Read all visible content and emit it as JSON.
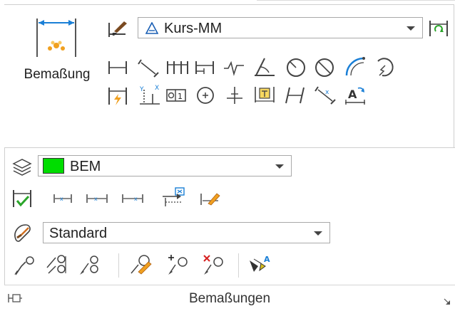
{
  "dimension_panel": {
    "big_button_label": "Bemaßung",
    "dimstyle_combo": {
      "value": "Kurs-MM"
    }
  },
  "dimensions_panel": {
    "layer_combo": {
      "value": "BEM",
      "color": "#00dd00"
    },
    "style_combo": {
      "value": "Standard"
    },
    "title": "Bemaßungen"
  },
  "colors": {
    "blue": "#1a7fd6",
    "green": "#2aa52a",
    "red": "#d62020",
    "orange": "#f0a020"
  }
}
